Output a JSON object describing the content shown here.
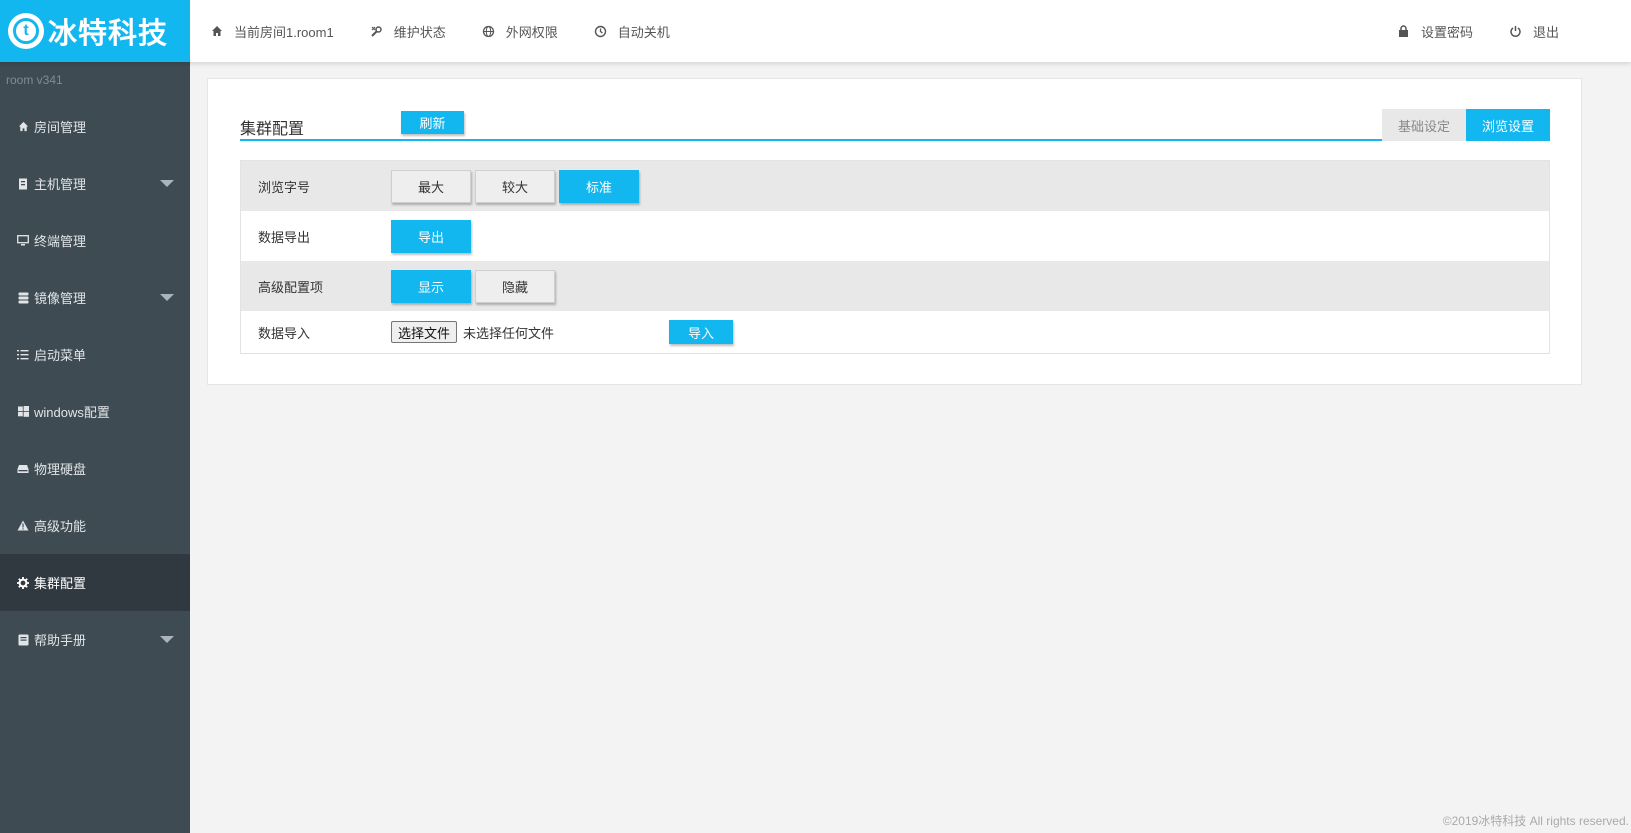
{
  "brand": {
    "logo_letter": "t",
    "name": "冰特科技"
  },
  "topnav": [
    {
      "label": "当前房间1.room1",
      "icon": "home-icon"
    },
    {
      "label": "维护状态",
      "icon": "tools-icon"
    },
    {
      "label": "外网权限",
      "icon": "globe-icon"
    },
    {
      "label": "自动关机",
      "icon": "clock-icon"
    }
  ],
  "topright": [
    {
      "label": "设置密码",
      "icon": "lock-icon"
    },
    {
      "label": "退出",
      "icon": "power-icon"
    }
  ],
  "sidebar": {
    "version": "room  v341",
    "items": [
      {
        "label": "房间管理",
        "icon": "home-icon"
      },
      {
        "label": "主机管理",
        "icon": "server-icon"
      },
      {
        "label": "终端管理",
        "icon": "monitor-icon"
      },
      {
        "label": "镜像管理",
        "icon": "database-icon"
      },
      {
        "label": "启动菜单",
        "icon": "list-icon"
      },
      {
        "label": "windows配置",
        "icon": "windows-icon"
      },
      {
        "label": "物理硬盘",
        "icon": "hdd-icon"
      },
      {
        "label": "高级功能",
        "icon": "warning-icon"
      },
      {
        "label": "集群配置",
        "icon": "gear-icon"
      },
      {
        "label": "帮助手册",
        "icon": "book-icon"
      }
    ]
  },
  "panel": {
    "title": "集群配置",
    "refresh_label": "刷新",
    "tabs": [
      "基础设定",
      "浏览设置"
    ]
  },
  "rows": {
    "font_size": {
      "label": "浏览字号",
      "options": [
        "最大",
        "较大",
        "标准"
      ],
      "selected": "标准"
    },
    "export": {
      "label": "数据导出",
      "button": "导出"
    },
    "advanced": {
      "label": "高级配置项",
      "options": [
        "显示",
        "隐藏"
      ],
      "selected": "显示"
    },
    "import": {
      "label": "数据导入",
      "file_button": "选择文件",
      "file_status": "未选择任何文件",
      "button": "导入"
    }
  },
  "footer": "©2019冰特科技 All rights reserved.",
  "colors": {
    "accent": "#12b7f0",
    "sidebar": "#3e4b53",
    "sidebar_active": "#2f393f"
  }
}
